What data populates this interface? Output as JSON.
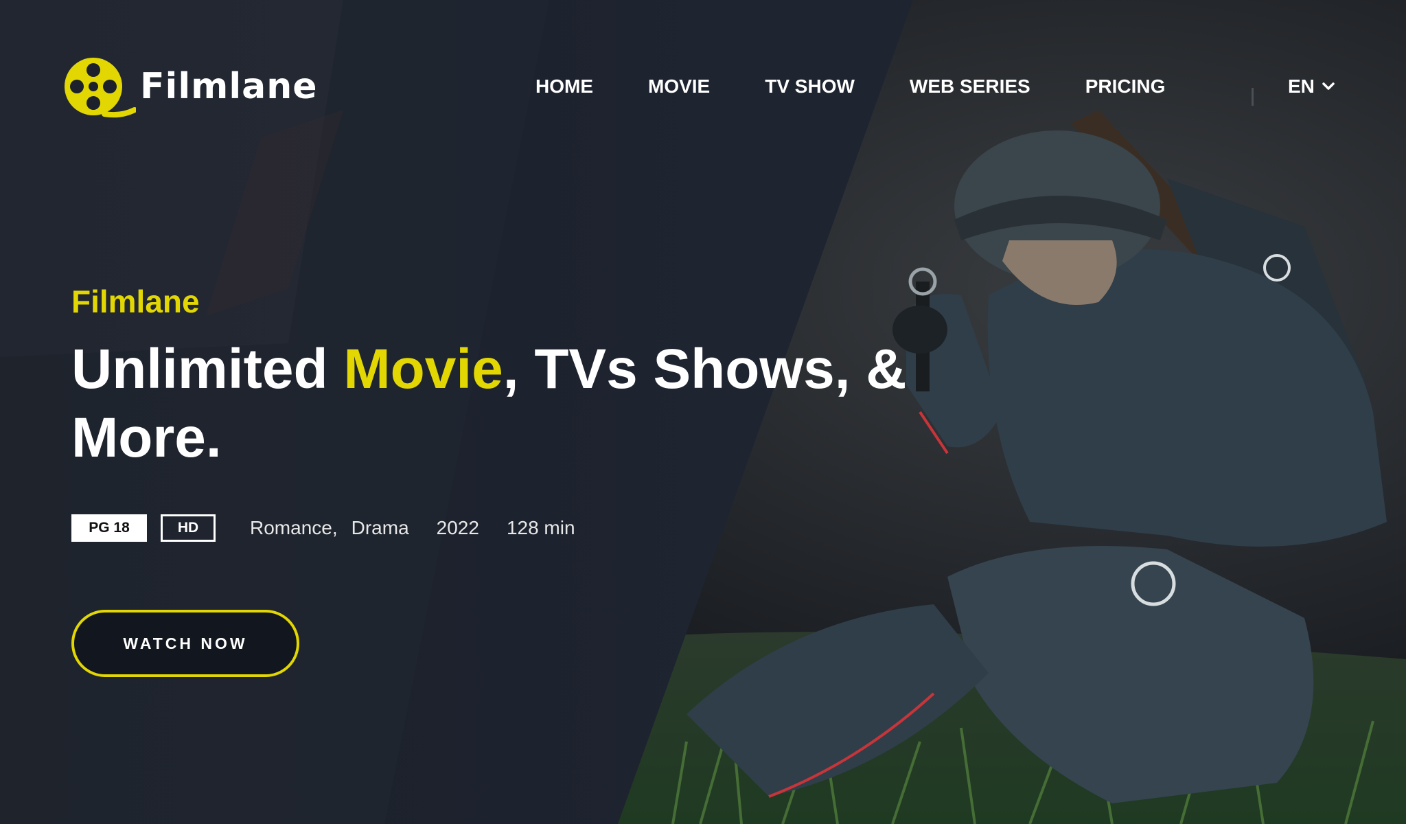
{
  "brand": {
    "name": "Filmlane",
    "logo_icon": "film-reel-icon",
    "accent_color": "#e2d703"
  },
  "nav": {
    "items": [
      {
        "label": "HOME"
      },
      {
        "label": "MOVIE"
      },
      {
        "label": "TV SHOW"
      },
      {
        "label": "WEB SERIES"
      },
      {
        "label": "PRICING"
      }
    ],
    "language": "EN",
    "language_icon": "chevron-down-icon"
  },
  "hero": {
    "subtitle": "Filmlane",
    "headline_part1": "Unlimited ",
    "headline_highlight": "Movie",
    "headline_part2": ", TVs Shows, & More.",
    "badges": {
      "rating": "PG 18",
      "quality": "HD"
    },
    "genres": [
      "Romance,",
      "Drama"
    ],
    "year": "2022",
    "duration": "128 min",
    "cta_label": "WATCH NOW"
  }
}
